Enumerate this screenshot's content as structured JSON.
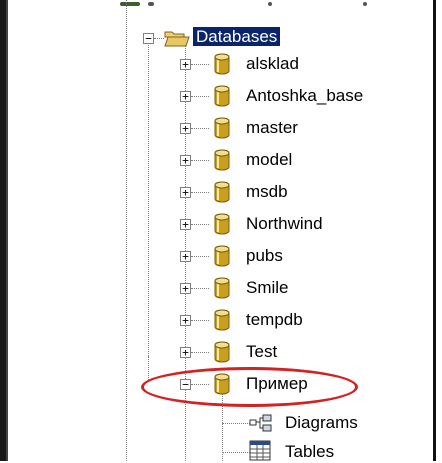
{
  "tree": {
    "root_label": "Databases",
    "databases": [
      {
        "label": "alsklad",
        "expander": "+"
      },
      {
        "label": "Antoshka_base",
        "expander": "+"
      },
      {
        "label": "master",
        "expander": "+"
      },
      {
        "label": "model",
        "expander": "+"
      },
      {
        "label": "msdb",
        "expander": "+"
      },
      {
        "label": "Northwind",
        "expander": "+"
      },
      {
        "label": "pubs",
        "expander": "+"
      },
      {
        "label": "Smile",
        "expander": "+"
      },
      {
        "label": "tempdb",
        "expander": "+"
      },
      {
        "label": "Test",
        "expander": "+"
      },
      {
        "label": "Пример",
        "expander": "−",
        "highlighted": true
      }
    ],
    "children_of_selected": [
      {
        "label": "Diagrams",
        "icon": "diagram-icon"
      },
      {
        "label": "Tables",
        "icon": "table-icon"
      }
    ]
  },
  "colors": {
    "selection_bg": "#0a246a",
    "highlight_ellipse": "#d32222",
    "db_icon": "#c8a020",
    "folder_icon": "#e8c860"
  }
}
